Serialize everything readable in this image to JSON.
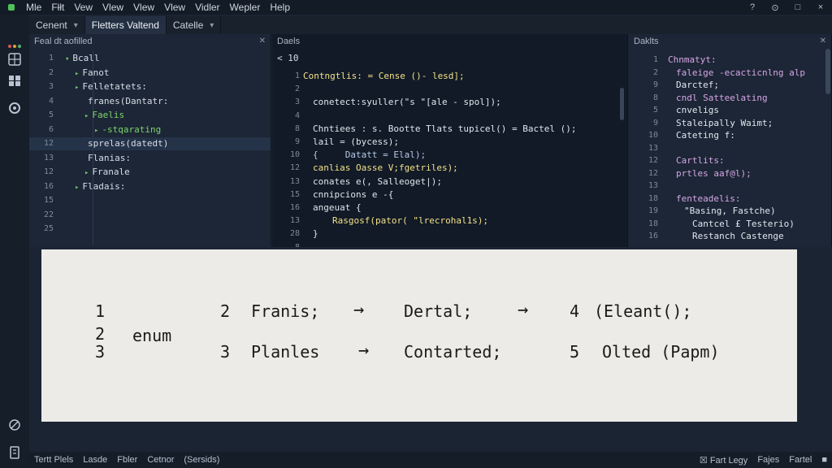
{
  "menu": [
    "Mle",
    "Fłłt",
    "Vew",
    "Vlew",
    "Vlew",
    "Vlew",
    "Vidler",
    "Wepler",
    "Help"
  ],
  "window_controls": [
    "?",
    "⊙",
    "□",
    "×"
  ],
  "tabs": [
    {
      "label": "Cenent",
      "close": "▾"
    },
    {
      "label": "Fletters Valtend",
      "close": ""
    },
    {
      "label": "Catelle",
      "close": "▾"
    }
  ],
  "left_panel": {
    "title": "Feal dt aofilled",
    "close": "✕",
    "rows": [
      {
        "num": "1",
        "caret": "▾",
        "label": "Bcall",
        "indent": 0,
        "green": false
      },
      {
        "num": "2",
        "caret": "▸",
        "label": "Fanot",
        "indent": 1,
        "green": false
      },
      {
        "num": "3",
        "caret": "▸",
        "label": "Felletatets:",
        "indent": 1,
        "green": false
      },
      {
        "num": "4",
        "caret": "",
        "label": "franes(Dantatr:",
        "indent": 2,
        "green": false
      },
      {
        "num": "5",
        "caret": "▸",
        "label": "Faelis",
        "indent": 2,
        "green": true
      },
      {
        "num": "6",
        "caret": "▸",
        "label": "-stqarating",
        "indent": 3,
        "green": true
      },
      {
        "num": "12",
        "caret": "",
        "label": "sprelas(datedt)",
        "indent": 2,
        "green": false,
        "selected": true
      },
      {
        "num": "13",
        "caret": "",
        "label": "Flanias:",
        "indent": 2,
        "green": false
      },
      {
        "num": "12",
        "caret": "▸",
        "label": "Franale",
        "indent": 2,
        "green": false
      },
      {
        "num": "16",
        "caret": "▸",
        "label": "Fladais:",
        "indent": 1,
        "green": false
      },
      {
        "num": "15",
        "caret": "",
        "label": "",
        "indent": 0,
        "green": false
      },
      {
        "num": "22",
        "caret": "",
        "label": "",
        "indent": 0,
        "green": false
      },
      {
        "num": "25",
        "caret": "",
        "label": "",
        "indent": 0,
        "green": false
      }
    ]
  },
  "editor": {
    "title": "Daels",
    "header_line": "< 10",
    "lines": [
      {
        "num": "1",
        "text": "Contngtlis: = Cense ()- lesd];",
        "color": "yellow",
        "indent": 0
      },
      {
        "num": "2",
        "text": "",
        "color": "light",
        "indent": 0
      },
      {
        "num": "3",
        "text": "conetect:syuller(\"s \"[ale - spol]);",
        "color": "light",
        "indent": 1
      },
      {
        "num": "4",
        "text": "",
        "color": "light",
        "indent": 0
      },
      {
        "num": "8",
        "text": "Chntiees : s. Bootte Tlats tupicel() = Bactel ();",
        "color": "light",
        "indent": 1
      },
      {
        "num": "9",
        "text": "lail = (bycess);",
        "color": "light",
        "indent": 1
      },
      {
        "num": "10",
        "text": "{     Datatt = Elal);",
        "color": "lblue",
        "indent": 1
      },
      {
        "num": "12",
        "text": "canlias Oasse V;fgetriles);",
        "color": "yellow",
        "indent": 1
      },
      {
        "num": "13",
        "text": "conates e(, Salleoget|);",
        "color": "light",
        "indent": 1
      },
      {
        "num": "15",
        "text": "cnnipcions e -{",
        "color": "light",
        "indent": 1
      },
      {
        "num": "16",
        "text": "angeuat {",
        "color": "light",
        "indent": 1
      },
      {
        "num": "13",
        "text": "Rasgosf(pator( \"lrecrohal1s);",
        "color": "yellow",
        "indent": 3
      },
      {
        "num": "28",
        "text": "}",
        "color": "light",
        "indent": 1
      },
      {
        "num": "8",
        "text": "",
        "color": "light",
        "indent": 0
      }
    ]
  },
  "right_panel": {
    "title": "Daklts",
    "close": "✕",
    "lines": [
      {
        "num": "1",
        "text": "Chnmatyt:",
        "color": "purple",
        "indent": 0
      },
      {
        "num": "2",
        "text": "faleige -ecacticnlng alp",
        "color": "purple",
        "indent": 1
      },
      {
        "num": "9",
        "text": "Darctef;",
        "color": "light",
        "indent": 1
      },
      {
        "num": "8",
        "text": "cndl Satteelating",
        "color": "purple",
        "indent": 1
      },
      {
        "num": "5",
        "text": "cnveligs",
        "color": "light",
        "indent": 1
      },
      {
        "num": "9",
        "text": "Staleipally Waimt;",
        "color": "light",
        "indent": 1
      },
      {
        "num": "10",
        "text": "Cateting f:",
        "color": "light",
        "indent": 1
      },
      {
        "num": "13",
        "text": "",
        "color": "light",
        "indent": 0
      },
      {
        "num": "12",
        "text": "Cartlits:",
        "color": "purple",
        "indent": 1
      },
      {
        "num": "12",
        "text": "prtles aaf@l);",
        "color": "purple",
        "indent": 1
      },
      {
        "num": "13",
        "text": "",
        "color": "light",
        "indent": 0
      },
      {
        "num": "18",
        "text": "fenteadelis:",
        "color": "purple",
        "indent": 1
      },
      {
        "num": "19",
        "text": "\"Basing, Fastche)",
        "color": "light",
        "indent": 2
      },
      {
        "num": "18",
        "text": "Cantcel £ Testerio)",
        "color": "light",
        "indent": 3
      },
      {
        "num": "16",
        "text": "Restanch Castenge",
        "color": "light",
        "indent": 3
      }
    ]
  },
  "overlay": {
    "row1": {
      "num": "1",
      "a": "2",
      "b": "Franis;",
      "c": "Dertal;",
      "d": "4",
      "e": "(Eleant();"
    },
    "row2": {
      "num": "2",
      "word": "enum"
    },
    "row3": {
      "num": "3",
      "a": "3",
      "b": "Planles",
      "c": "Contarted;",
      "d": "5",
      "e": "Olted (Papm)"
    },
    "arrow": "→"
  },
  "statusbar": {
    "left": [
      "Tertt Plels",
      "Lasde",
      "Fbler",
      "Cetnor",
      "(Sersids)"
    ],
    "right": [
      "☒ Fart Legy",
      "Fajes",
      "Fartel",
      "■"
    ]
  },
  "colors": {
    "accent_green": "#4fc35a",
    "bg": "#1b2433"
  }
}
